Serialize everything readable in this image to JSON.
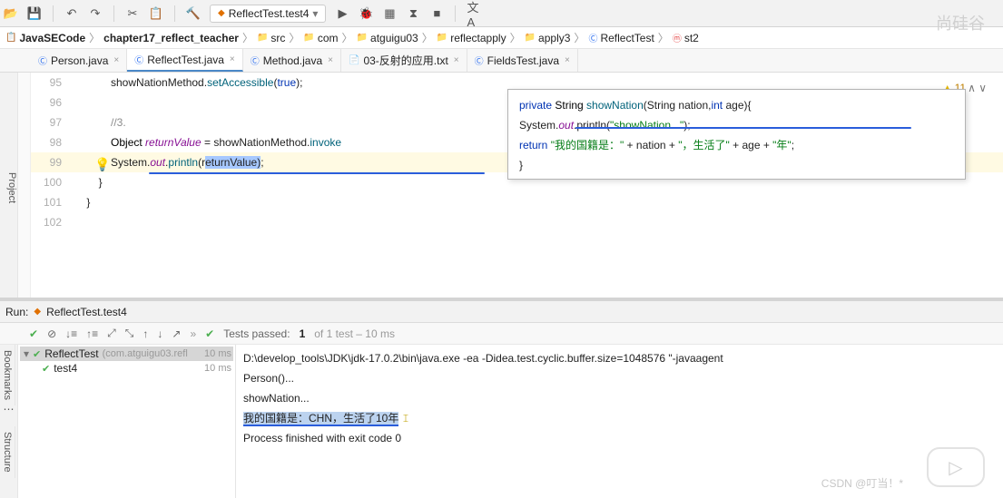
{
  "toolbar": {
    "run_config": "ReflectTest.test4"
  },
  "breadcrumbs": [
    {
      "icon": "📋",
      "label": "JavaSECode",
      "bold": true
    },
    {
      "icon": "",
      "label": "chapter17_reflect_teacher",
      "bold": true
    },
    {
      "icon": "📁",
      "label": "src"
    },
    {
      "icon": "📁",
      "label": "com"
    },
    {
      "icon": "📁",
      "label": "atguigu03"
    },
    {
      "icon": "📁",
      "label": "reflectapply"
    },
    {
      "icon": "📁",
      "label": "apply3"
    },
    {
      "icon": "Ⓒ",
      "label": "ReflectTest",
      "cls": "blue"
    },
    {
      "icon": "ⓜ",
      "label": "st2",
      "cls": "red"
    }
  ],
  "tabs": [
    {
      "icon": "Ⓒ",
      "label": "Person.java",
      "cls": "blue"
    },
    {
      "icon": "Ⓒ",
      "label": "ReflectTest.java",
      "cls": "blue",
      "active": true
    },
    {
      "icon": "Ⓒ",
      "label": "Method.java",
      "cls": "blue"
    },
    {
      "icon": "📄",
      "label": "03-反射的应用.txt"
    },
    {
      "icon": "Ⓒ",
      "label": "FieldsTest.java",
      "cls": "blue"
    }
  ],
  "side_labels": {
    "project": "Project",
    "bookmarks": "Bookmarks",
    "structure": "Structure"
  },
  "warnings": {
    "count": "11"
  },
  "editor": {
    "lines": [
      {
        "n": "95",
        "seg": [
          {
            "t": "            showNationMethod."
          },
          {
            "t": "setAccessible",
            "c": "method"
          },
          {
            "t": "("
          },
          {
            "t": "true",
            "c": "kw"
          },
          {
            "t": ");"
          }
        ]
      },
      {
        "n": "96",
        "seg": []
      },
      {
        "n": "97",
        "seg": [
          {
            "t": "            "
          },
          {
            "t": "//3.",
            "c": "comment"
          }
        ]
      },
      {
        "n": "98",
        "seg": [
          {
            "t": "            "
          },
          {
            "t": "Object",
            "c": "ident"
          },
          {
            "t": " "
          },
          {
            "t": "returnValue",
            "c": "field"
          },
          {
            "t": " = showNationMethod."
          },
          {
            "t": "invoke",
            "c": "method"
          }
        ]
      },
      {
        "n": "99",
        "hl": true,
        "seg": [
          {
            "t": "            System."
          },
          {
            "t": "out",
            "c": "field"
          },
          {
            "t": "."
          },
          {
            "t": "println",
            "c": "method"
          },
          {
            "t": "(r"
          },
          {
            "t": "eturnValue)",
            "c": "sel"
          },
          {
            "t": ";                                                                                               "
          }
        ]
      },
      {
        "n": "100",
        "seg": [
          {
            "t": "        }"
          }
        ]
      },
      {
        "n": "101",
        "seg": [
          {
            "t": "    }"
          }
        ]
      },
      {
        "n": "102",
        "seg": []
      }
    ],
    "popup": {
      "lines": [
        [
          {
            "t": "private ",
            "c": "kw"
          },
          {
            "t": "String ",
            "c": "ident"
          },
          {
            "t": "showNation",
            "c": "method"
          },
          {
            "t": "(String nation,"
          },
          {
            "t": "int ",
            "c": "kw"
          },
          {
            "t": "age){"
          }
        ],
        [
          {
            "t": "    System."
          },
          {
            "t": "out",
            "c": "field"
          },
          {
            "t": ".println("
          },
          {
            "t": "\"showNation...\"",
            "c": "str"
          },
          {
            "t": ");"
          }
        ],
        [
          {
            "t": "    "
          },
          {
            "t": "return ",
            "c": "kw"
          },
          {
            "t": "\"我的国籍是：\"",
            "c": "str"
          },
          {
            "t": " + nation + "
          },
          {
            "t": "\"，生活了\"",
            "c": "str"
          },
          {
            "t": " + age + "
          },
          {
            "t": "\"年\"",
            "c": "str"
          },
          {
            "t": ";"
          }
        ],
        [
          {
            "t": "}"
          }
        ]
      ]
    }
  },
  "run": {
    "title_prefix": "Run:",
    "title_config": "ReflectTest.test4",
    "tests_label": "Tests passed:",
    "tests_count": "1",
    "tests_of": "of 1 test – 10 ms",
    "tree": [
      {
        "name": "ReflectTest",
        "pkg": "(com.atguigu03.refl",
        "time": "10 ms",
        "sel": true
      },
      {
        "name": "test4",
        "pkg": "",
        "time": "10 ms",
        "indent": 1
      }
    ],
    "console_lines": [
      "D:\\develop_tools\\JDK\\jdk-17.0.2\\bin\\java.exe -ea -Didea.test.cyclic.buffer.size=1048576 \"-javaagent",
      "Person()...",
      "showNation...",
      "",
      "",
      "Process finished with exit code 0"
    ],
    "console_highlight": "我的国籍是：CHN，生活了10年"
  },
  "watermark": "尚硅谷",
  "csdn": "CSDN @叮当！*"
}
